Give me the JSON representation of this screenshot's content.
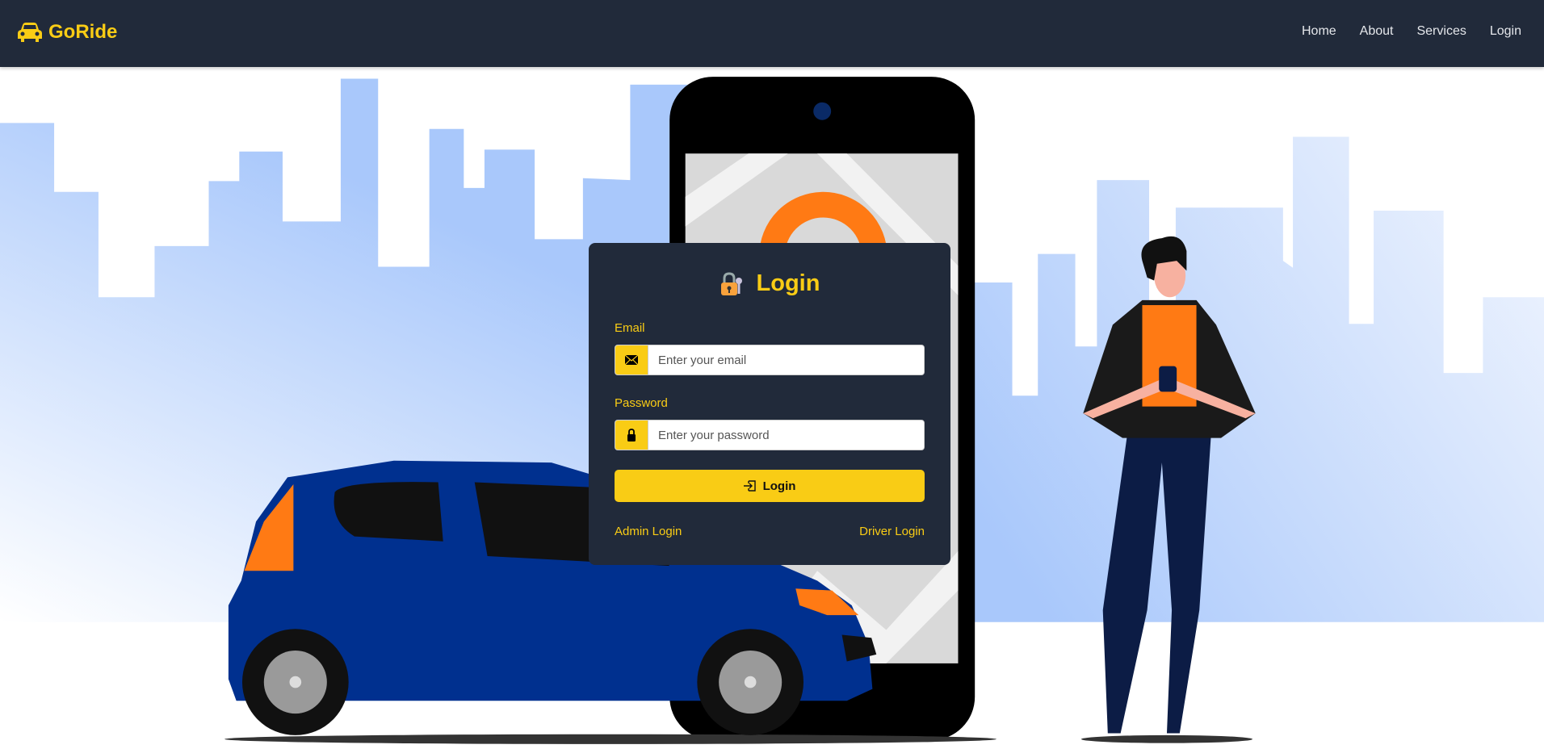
{
  "nav": {
    "brand": "GoRide",
    "links": [
      "Home",
      "About",
      "Services",
      "Login"
    ]
  },
  "login": {
    "title": "Login",
    "email_label": "Email",
    "email_placeholder": "Enter your email",
    "email_value": "",
    "password_label": "Password",
    "password_placeholder": "Enter your password",
    "password_value": "",
    "submit_label": "Login",
    "admin_link": "Admin Login",
    "driver_link": "Driver Login"
  },
  "colors": {
    "accent": "#f9cc15",
    "navbar": "#212a3a",
    "car": "#00308f",
    "orange": "#ff7a14"
  }
}
